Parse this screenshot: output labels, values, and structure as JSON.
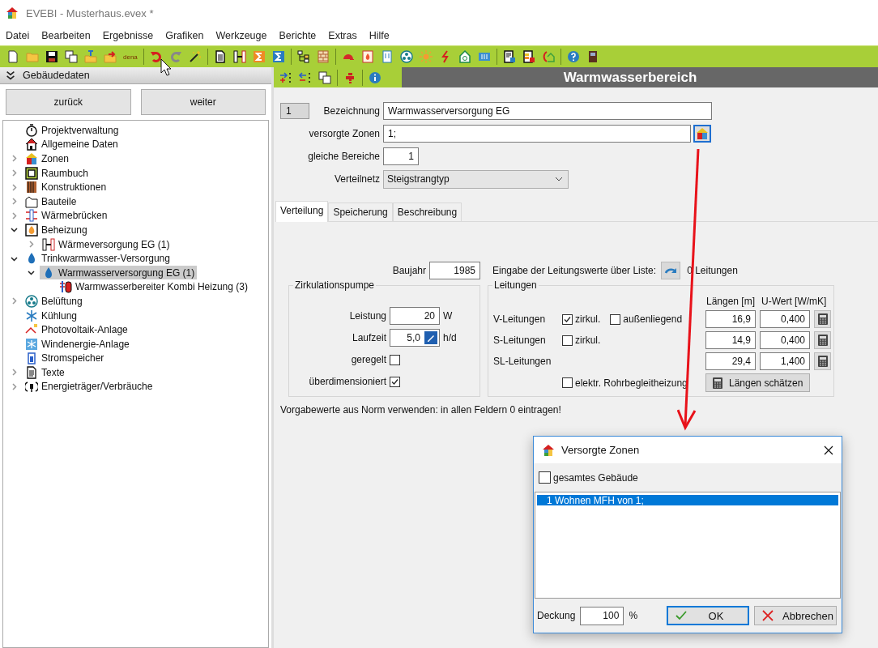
{
  "window": {
    "title": "EVEBI - Musterhaus.evex *"
  },
  "menu": [
    "Datei",
    "Bearbeiten",
    "Ergebnisse",
    "Grafiken",
    "Werkzeuge",
    "Berichte",
    "Extras",
    "Hilfe"
  ],
  "toolbar": {
    "dena_label": "dena"
  },
  "sidebar": {
    "title": "Gebäudedaten",
    "buttons": [
      "zurück",
      "weiter"
    ],
    "tree": [
      {
        "label": "Projektverwaltung",
        "kind": "stopwatch",
        "selected": false
      },
      {
        "label": "Allgemeine Daten",
        "kind": "house",
        "selected": false
      },
      {
        "label": "Zonen",
        "kind": "zones",
        "expanded": false,
        "selected": false
      },
      {
        "label": "Raumbuch",
        "kind": "plan",
        "expanded": false,
        "selected": false
      },
      {
        "label": "Konstruktionen",
        "kind": "construction",
        "expanded": false,
        "selected": false
      },
      {
        "label": "Bauteile",
        "kind": "outline",
        "expanded": false,
        "selected": false
      },
      {
        "label": "Wärmebrücken",
        "kind": "bridge",
        "expanded": false,
        "selected": false
      },
      {
        "label": "Beheizung",
        "kind": "heating",
        "expanded": true,
        "selected": false,
        "children": [
          {
            "label": "Wärmeversorgung EG (1)",
            "kind": "pipes",
            "expanded": false,
            "selected": false
          }
        ]
      },
      {
        "label": "Trinkwarmwasser-Versorgung",
        "kind": "drop",
        "expanded": true,
        "selected": false,
        "children": [
          {
            "label": "Warmwasserversorgung EG (1)",
            "kind": "drop",
            "expanded": true,
            "selected": true,
            "children": [
              {
                "label": "Warmwasserbereiter Kombi Heizung (3)",
                "kind": "boiler",
                "selected": false
              }
            ]
          }
        ]
      },
      {
        "label": "Belüftung",
        "kind": "fan",
        "expanded": false,
        "selected": false
      },
      {
        "label": "Kühlung",
        "kind": "snow",
        "selected": false
      },
      {
        "label": "Photovoltaik-Anlage",
        "kind": "solar",
        "selected": false
      },
      {
        "label": "Windenergie-Anlage",
        "kind": "wind",
        "selected": false
      },
      {
        "label": "Stromspeicher",
        "kind": "battery",
        "selected": false
      },
      {
        "label": "Texte",
        "kind": "text",
        "expanded": false,
        "selected": false
      },
      {
        "label": "Energieträger/Verbräuche",
        "kind": "plug",
        "expanded": false,
        "selected": false
      }
    ]
  },
  "panel": {
    "title": "Warmwasserbereich"
  },
  "form": {
    "number": "1",
    "name_label": "Bezeichnung",
    "name_value": "Warmwasserversorgung EG",
    "zones_label": "versorgte Zonen",
    "zones_value": "1;",
    "equal_label": "gleiche Bereiche",
    "equal_value": "1",
    "network_label": "Verteilnetz",
    "network_value": "Steigstrangtyp"
  },
  "tabs": [
    {
      "label": "Verteilung",
      "selected": true
    },
    {
      "label": "Speicherung",
      "selected": false
    },
    {
      "label": "Beschreibung",
      "selected": false
    }
  ],
  "distribution": {
    "year_label": "Baujahr",
    "year_value": "1985",
    "list_label": "Eingabe der Leitungswerte über Liste:",
    "list_count": "0 Leitungen",
    "pump": {
      "title": "Zirkulationspumpe",
      "power_label": "Leistung",
      "power_value": "20",
      "power_unit": "W",
      "runtime_label": "Laufzeit",
      "runtime_value": "5,0",
      "runtime_unit": "h/d",
      "controlled": {
        "label": "geregelt",
        "checked": false
      },
      "oversized": {
        "label": "überdimensioniert",
        "checked": true
      }
    },
    "pipes": {
      "title": "Leitungen",
      "columns": [
        "Längen [m]",
        "U-Wert [W/mK]"
      ],
      "rows": [
        {
          "label": "V-Leitungen",
          "options": [
            {
              "label": "zirkul.",
              "checked": true
            },
            {
              "label": "außenliegend",
              "checked": false
            }
          ],
          "length": "16,9",
          "u_value": "0,400"
        },
        {
          "label": "S-Leitungen",
          "options": [
            {
              "label": "zirkul.",
              "checked": false
            }
          ],
          "length": "14,9",
          "u_value": "0,400"
        },
        {
          "label": "SL-Leitungen",
          "length": "29,4",
          "u_value": "1,400"
        }
      ],
      "heating": {
        "label": "elektr. Rohrbegleitheizung",
        "checked": false
      },
      "estimate_button": "Längen schätzen"
    },
    "note": "Vorgabewerte aus Norm verwenden: in allen Feldern 0 eintragen!"
  },
  "dialog": {
    "title": "Versorgte Zonen",
    "whole_building": {
      "label": "gesamtes Gebäude",
      "checked": false
    },
    "zones": [
      {
        "label": "1 Wohnen MFH von 1;",
        "selected": true
      }
    ],
    "coverage_label": "Deckung",
    "coverage_value": "100",
    "coverage_unit": "%",
    "ok": "OK",
    "cancel": "Abbrechen"
  }
}
